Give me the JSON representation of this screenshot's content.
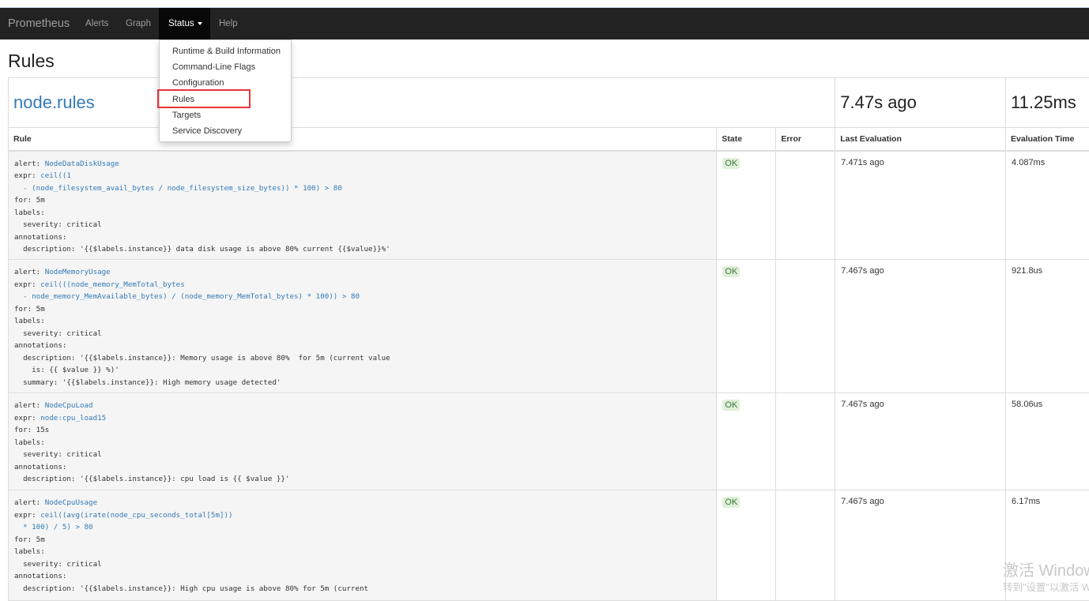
{
  "nav": {
    "brand": "Prometheus",
    "items": [
      "Alerts",
      "Graph",
      "Status",
      "Help"
    ]
  },
  "status_menu": [
    "Runtime & Build Information",
    "Command-Line Flags",
    "Configuration",
    "Rules",
    "Targets",
    "Service Discovery"
  ],
  "highlighted_menu_item": "Rules",
  "page_title": "Rules",
  "group": {
    "name": "node.rules",
    "last_evaluation": "7.47s ago",
    "evaluation_time": "11.25ms"
  },
  "columns": [
    "Rule",
    "State",
    "Error",
    "Last Evaluation",
    "Evaluation Time"
  ],
  "rules": [
    {
      "alert": "NodeDataDiskUsage",
      "expr": [
        "ceil((1",
        "  - (node_filesystem_avail_bytes / node_filesystem_size_bytes)) * 100) > 80"
      ],
      "for": "5m",
      "severity": "critical",
      "annotations": [
        "  description: '{{$labels.instance}} data disk usage is above 80% current {{$value}}%'"
      ],
      "state": "OK",
      "error": "",
      "last_evaluation": "7.471s ago",
      "evaluation_time": "4.087ms"
    },
    {
      "alert": "NodeMemoryUsage",
      "expr": [
        "ceil(((node_memory_MemTotal_bytes",
        "  - node_memory_MemAvailable_bytes) / (node_memory_MemTotal_bytes) * 100)) > 80"
      ],
      "for": "5m",
      "severity": "critical",
      "annotations": [
        "  description: '{{$labels.instance}}: Memory usage is above 80%  for 5m (current value",
        "    is: {{ $value }} %)'",
        "  summary: '{{$labels.instance}}: High memory usage detected'"
      ],
      "state": "OK",
      "error": "",
      "last_evaluation": "7.467s ago",
      "evaluation_time": "921.8us"
    },
    {
      "alert": "NodeCpuLoad",
      "expr": [
        "node:cpu_load15"
      ],
      "for": "15s",
      "severity": "critical",
      "annotations": [
        "  description: '{{$labels.instance}}: cpu load is {{ $value }}'"
      ],
      "state": "OK",
      "error": "",
      "last_evaluation": "7.467s ago",
      "evaluation_time": "58.06us"
    },
    {
      "alert": "NodeCpuUsage",
      "expr": [
        "ceil((avg(irate(node_cpu_seconds_total[5m]))",
        "  * 100) / 5) > 80"
      ],
      "for": "5m",
      "severity": "critical",
      "annotations": [
        "  description: '{{$labels.instance}}: High cpu usage is above 80% for 5m (current"
      ],
      "state": "OK",
      "error": "",
      "last_evaluation": "7.467s ago",
      "evaluation_time": "6.17ms"
    }
  ],
  "watermark": {
    "line1": "激活 Windows",
    "line2": "转到\"设置\"以激活 Windows。"
  }
}
